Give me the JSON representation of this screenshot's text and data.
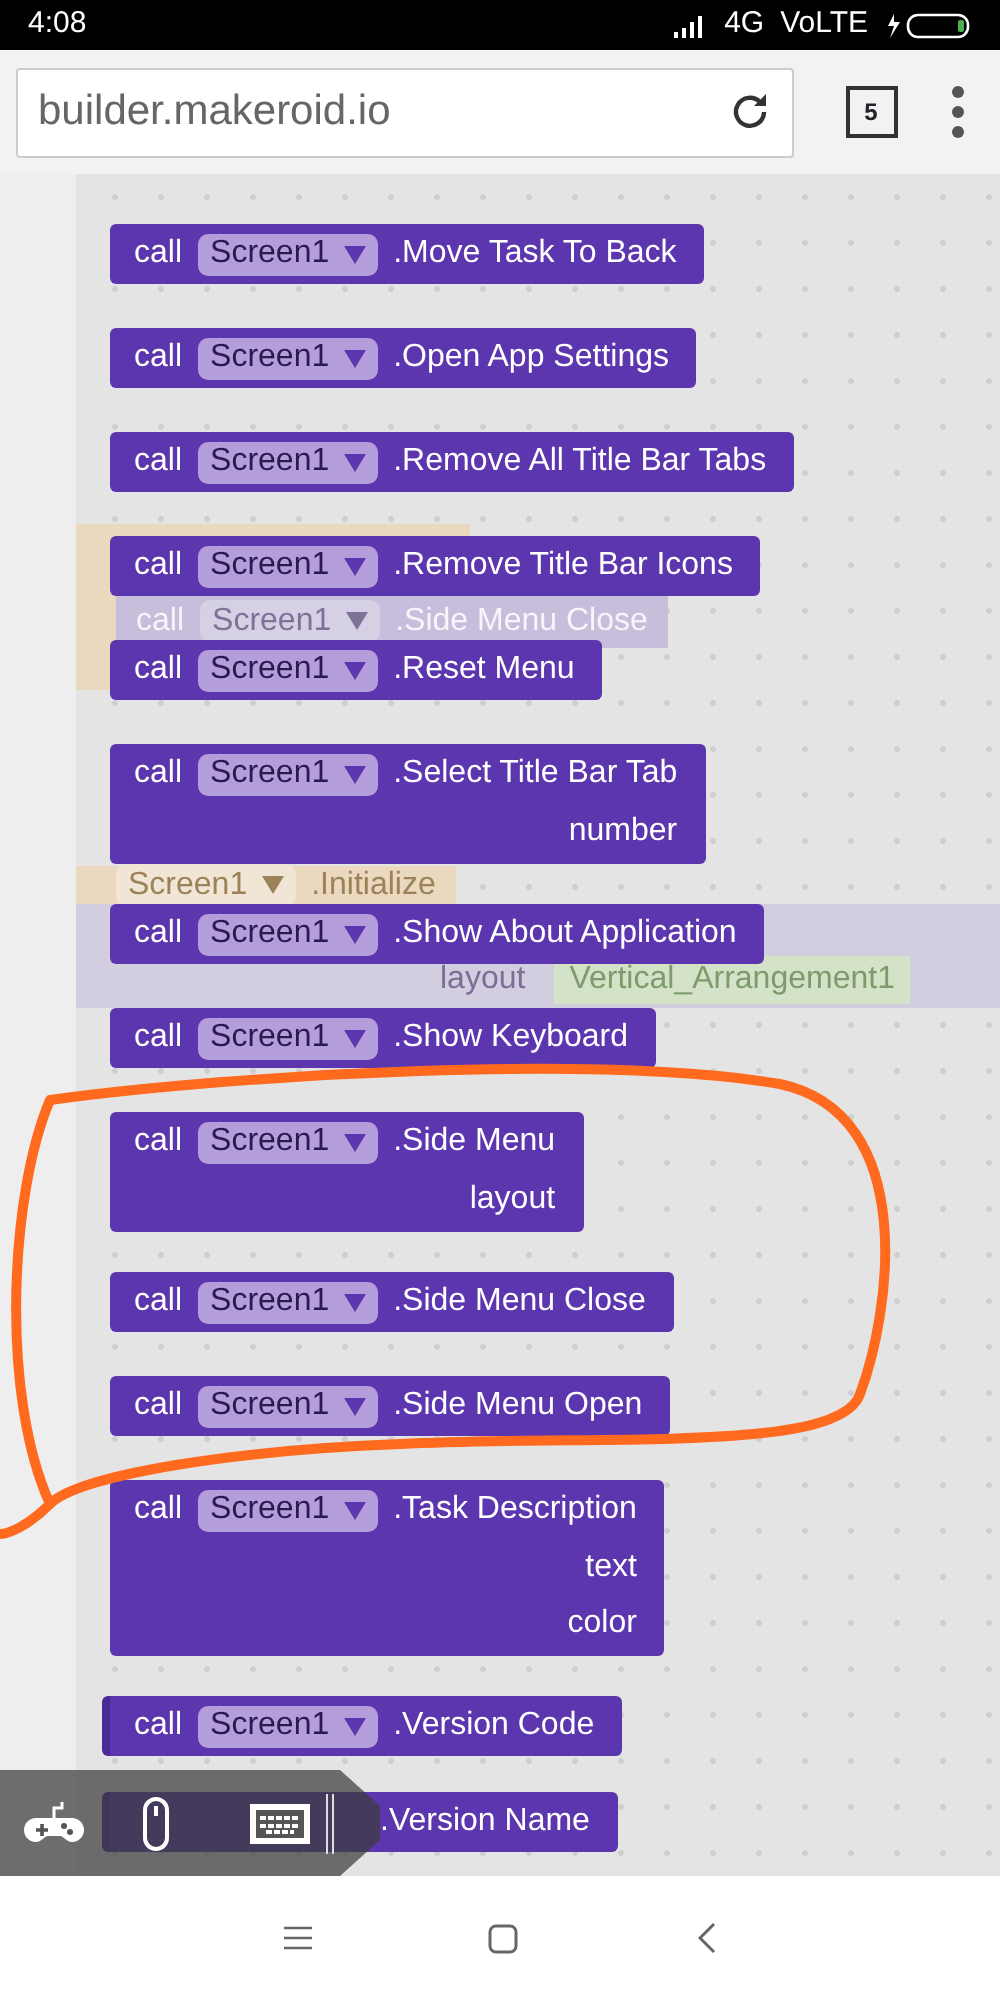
{
  "status_bar": {
    "time": "4:08",
    "network": "4G",
    "volte": "VoLTE"
  },
  "browser": {
    "url": "builder.makeroid.io",
    "tab_count": "5"
  },
  "workspace": {
    "blocks": [
      {
        "kind": "statement",
        "call": "call",
        "component": "Screen1",
        "method": ".Move Task To Back"
      },
      {
        "kind": "statement",
        "call": "call",
        "component": "Screen1",
        "method": ".Open App Settings"
      },
      {
        "kind": "statement",
        "call": "call",
        "component": "Screen1",
        "method": ".Remove All Title Bar Tabs"
      },
      {
        "kind": "statement",
        "call": "call",
        "component": "Screen1",
        "method": ".Remove Title Bar Icons"
      },
      {
        "kind": "statement",
        "call": "call",
        "component": "Screen1",
        "method": ".Reset Menu"
      },
      {
        "kind": "statement",
        "call": "call",
        "component": "Screen1",
        "method": ".Select Title Bar Tab",
        "params": [
          "number"
        ]
      },
      {
        "kind": "statement",
        "call": "call",
        "component": "Screen1",
        "method": ".Show About Application"
      },
      {
        "kind": "statement",
        "call": "call",
        "component": "Screen1",
        "method": ".Show Keyboard"
      },
      {
        "kind": "statement",
        "call": "call",
        "component": "Screen1",
        "method": ".Side Menu",
        "params": [
          "layout"
        ]
      },
      {
        "kind": "statement",
        "call": "call",
        "component": "Screen1",
        "method": ".Side Menu Close"
      },
      {
        "kind": "statement",
        "call": "call",
        "component": "Screen1",
        "method": ".Side Menu Open"
      },
      {
        "kind": "statement",
        "call": "call",
        "component": "Screen1",
        "method": ".Task Description",
        "params": [
          "text",
          "color"
        ]
      },
      {
        "kind": "value",
        "call": "call",
        "component": "Screen1",
        "method": ".Version Code"
      },
      {
        "kind": "value",
        "method": ".Version Name"
      }
    ],
    "ghost_blocks": [
      {
        "kind": "event_body"
      },
      {
        "kind": "call",
        "call": "call",
        "component": "Screen1",
        "method": ".Side Menu Close"
      },
      {
        "kind": "event",
        "component": "Screen1",
        "method": ".Initialize"
      },
      {
        "kind": "param",
        "label": "layout",
        "value": "Vertical_Arrangement1"
      }
    ]
  }
}
